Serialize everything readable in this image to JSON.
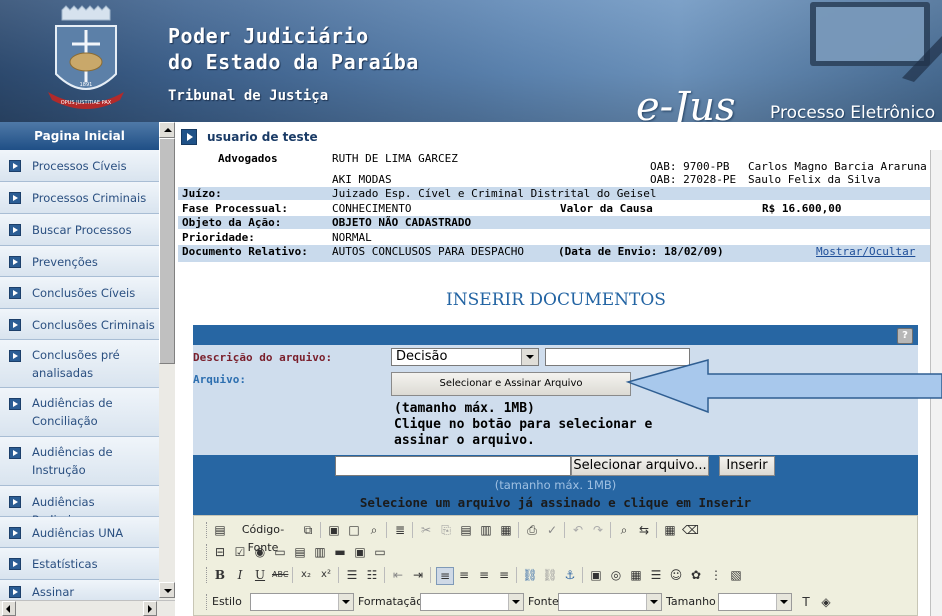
{
  "header": {
    "title_line1": "Poder Judiciário",
    "title_line2": "do Estado da Paraíba",
    "subtitle": "Tribunal de Justiça",
    "logo_text": "e-Jus",
    "logo_caption": "Processo Eletrônico",
    "crest_motto": "OPUS JUSTITIAE PAX",
    "crest_year": "1891"
  },
  "sidebar": {
    "heading": "Pagina Inicial",
    "items": [
      {
        "label": "Processos Cíveis"
      },
      {
        "label": "Processos Criminais"
      },
      {
        "label": "Buscar Processos"
      },
      {
        "label": "Prevenções"
      },
      {
        "label": "Conclusões Cíveis"
      },
      {
        "label": "Conclusões Criminais"
      },
      {
        "label": "Conclusões pré analisadas"
      },
      {
        "label": "Audiências de Conciliação"
      },
      {
        "label": "Audiências de Instrução"
      },
      {
        "label": "Audiências Preliminar"
      },
      {
        "label": "Audiências UNA"
      },
      {
        "label": "Estatísticas"
      },
      {
        "label": "Assinar"
      }
    ]
  },
  "user": {
    "name": "usuario de teste"
  },
  "process_info": {
    "advogados_label": "Advogados",
    "advogados": [
      "RUTH DE LIMA GARCEZ",
      "AKI MODAS"
    ],
    "oab_1": "OAB: 9700-PB",
    "oab_2": "OAB: 27028-PE",
    "lawyer_1": "Carlos Magno Barcia Araruna",
    "lawyer_2": "Saulo Felix da Silva",
    "juizo_label": "Juízo:",
    "juizo": "Juizado Esp. Cível e Criminal Distrital do Geisel",
    "fase_label": "Fase Processual:",
    "fase": "CONHECIMENTO",
    "valor_label": "Valor da Causa",
    "valor": "R$ 16.600,00",
    "objeto_label": "Objeto da Ação:",
    "objeto": "OBJETO NÃO CADASTRADO",
    "prioridade_label": "Prioridade:",
    "prioridade": "NORMAL",
    "documento_label": "Documento Relativo:",
    "documento": "AUTOS CONCLUSOS PARA DESPACHO",
    "data_envio": "(Data de Envio: 18/02/09)",
    "toggle_link": "Mostrar/Ocultar"
  },
  "insert_form": {
    "title": "INSERIR DOCUMENTOS",
    "help_icon": "?",
    "descricao_label": "Descrição do arquivo:",
    "descricao_select": "Decisão",
    "descricao_input": "",
    "arquivo_label": "Arquivo:",
    "select_sign_button": "Selecionar e Assinar Arquivo",
    "hint_line1": "(tamanho máx. 1MB)",
    "hint_line2": "Clique no botão para selecionar e",
    "hint_line3": "assinar o arquivo.",
    "file_value": "",
    "select_file_button": "Selecionar arquivo...",
    "insert_button": "Inserir",
    "upload_max": "(tamanho máx. 1MB)",
    "upload_hint": "Selecione um arquivo já assinado e clique em Inserir"
  },
  "editor_toolbar": {
    "source_button": "Código-Fonte",
    "style_label": "Estilo",
    "format_label": "Formatação",
    "font_label": "Fonte",
    "size_label": "Tamanho",
    "icons": [
      "new-page-icon",
      "save-icon",
      "preview-icon",
      "templates-icon",
      "cut-icon",
      "copy-icon",
      "paste-icon",
      "paste-text-icon",
      "paste-word-icon",
      "print-icon",
      "spellcheck-icon",
      "undo-icon",
      "redo-icon",
      "find-icon",
      "replace-icon",
      "select-all-icon",
      "remove-format-icon"
    ]
  },
  "colors": {
    "header_blue": "#3f6491",
    "sidebar_bg": "#d9e3ee",
    "form_blue": "#2766a3",
    "form_light": "#cfdded",
    "label_red": "#7a1f2b",
    "title_blue": "#2364a3",
    "arrow_fill": "#a8c8ec"
  }
}
